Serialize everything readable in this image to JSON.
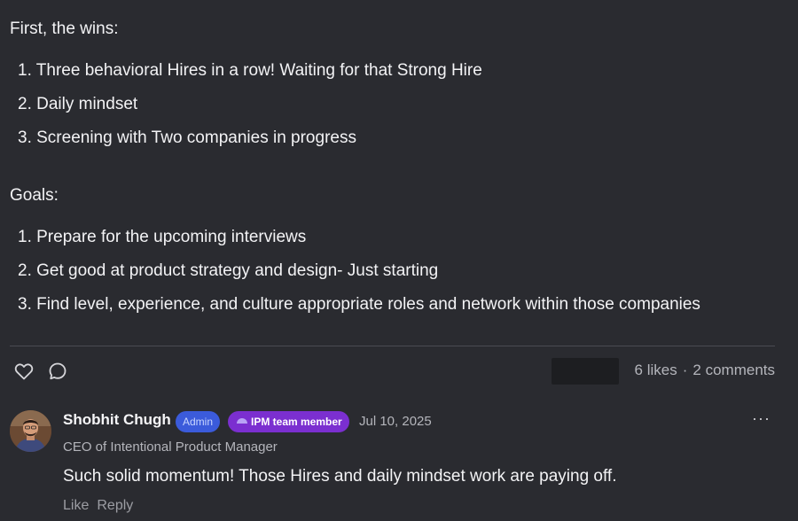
{
  "post": {
    "wins_heading": "First, the wins:",
    "wins": [
      "1. Three behavioral Hires in a row! Waiting for that Strong Hire",
      "2. Daily mindset",
      "3. Screening with Two companies in progress"
    ],
    "goals_heading": "Goals:",
    "goals": [
      "1. Prepare for the upcoming interviews",
      "2. Get good at product strategy and design- Just starting",
      "3. Find level, experience, and culture appropriate roles and network within those companies"
    ]
  },
  "engagement": {
    "likes_label": "6 likes",
    "separator": "·",
    "comments_label": "2 comments",
    "icons": {
      "like": "heart-icon",
      "comment": "comment-bubble-icon"
    }
  },
  "comment": {
    "author": "Shobhit Chugh",
    "badge_admin": "Admin",
    "badge_team": "IPM team member",
    "date": "Jul 10, 2025",
    "more": "···",
    "role": "CEO of Intentional Product Manager",
    "text": "Such solid momentum! Those Hires and daily mindset work are paying off.",
    "like_label": "Like",
    "reply_label": "Reply"
  },
  "colors": {
    "background": "#2a2b30",
    "admin_badge": "#3b5bdb",
    "team_badge": "#7b2fd0"
  }
}
